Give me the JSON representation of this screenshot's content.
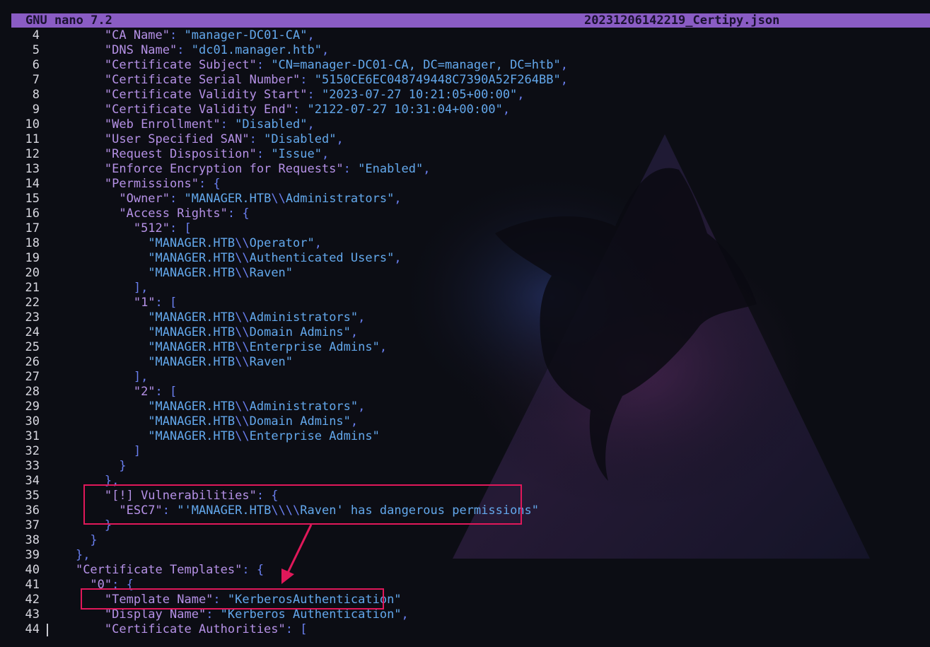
{
  "titlebar": {
    "app": "GNU nano 7.2",
    "filename": "20231206142219_Certipy.json"
  },
  "colors": {
    "titlebar_bg": "#8a5cc4",
    "json_key": "#b591e6",
    "json_string": "#63a8ec",
    "json_punct": "#6a7ff0",
    "highlight_box": "#e0185a",
    "background": "#0c0d14"
  },
  "lines": [
    {
      "n": "4",
      "indent": "    ",
      "tokens": [
        [
          "k",
          "\"CA Name\""
        ],
        [
          "p",
          ": "
        ],
        [
          "s",
          "\"manager-DC01-CA\""
        ],
        [
          "p",
          ","
        ]
      ]
    },
    {
      "n": "5",
      "indent": "    ",
      "tokens": [
        [
          "k",
          "\"DNS Name\""
        ],
        [
          "p",
          ": "
        ],
        [
          "s",
          "\"dc01.manager.htb\""
        ],
        [
          "p",
          ","
        ]
      ]
    },
    {
      "n": "6",
      "indent": "    ",
      "tokens": [
        [
          "k",
          "\"Certificate Subject\""
        ],
        [
          "p",
          ": "
        ],
        [
          "s",
          "\"CN=manager-DC01-CA, DC=manager, DC=htb\""
        ],
        [
          "p",
          ","
        ]
      ]
    },
    {
      "n": "7",
      "indent": "    ",
      "tokens": [
        [
          "k",
          "\"Certificate Serial Number\""
        ],
        [
          "p",
          ": "
        ],
        [
          "s",
          "\"5150CE6EC048749448C7390A52F264BB\""
        ],
        [
          "p",
          ","
        ]
      ]
    },
    {
      "n": "8",
      "indent": "    ",
      "tokens": [
        [
          "k",
          "\"Certificate Validity Start\""
        ],
        [
          "p",
          ": "
        ],
        [
          "s",
          "\"2023-07-27 10:21:05+00:00\""
        ],
        [
          "p",
          ","
        ]
      ]
    },
    {
      "n": "9",
      "indent": "    ",
      "tokens": [
        [
          "k",
          "\"Certificate Validity End\""
        ],
        [
          "p",
          ": "
        ],
        [
          "s",
          "\"2122-07-27 10:31:04+00:00\""
        ],
        [
          "p",
          ","
        ]
      ]
    },
    {
      "n": "10",
      "indent": "    ",
      "tokens": [
        [
          "k",
          "\"Web Enrollment\""
        ],
        [
          "p",
          ": "
        ],
        [
          "s",
          "\"Disabled\""
        ],
        [
          "p",
          ","
        ]
      ]
    },
    {
      "n": "11",
      "indent": "    ",
      "tokens": [
        [
          "k",
          "\"User Specified SAN\""
        ],
        [
          "p",
          ": "
        ],
        [
          "s",
          "\"Disabled\""
        ],
        [
          "p",
          ","
        ]
      ]
    },
    {
      "n": "12",
      "indent": "    ",
      "tokens": [
        [
          "k",
          "\"Request Disposition\""
        ],
        [
          "p",
          ": "
        ],
        [
          "s",
          "\"Issue\""
        ],
        [
          "p",
          ","
        ]
      ]
    },
    {
      "n": "13",
      "indent": "    ",
      "tokens": [
        [
          "k",
          "\"Enforce Encryption for Requests\""
        ],
        [
          "p",
          ": "
        ],
        [
          "s",
          "\"Enabled\""
        ],
        [
          "p",
          ","
        ]
      ]
    },
    {
      "n": "14",
      "indent": "    ",
      "tokens": [
        [
          "k",
          "\"Permissions\""
        ],
        [
          "p",
          ": {"
        ]
      ]
    },
    {
      "n": "15",
      "indent": "      ",
      "tokens": [
        [
          "k",
          "\"Owner\""
        ],
        [
          "p",
          ": "
        ],
        [
          "s",
          "\"MANAGER.HTB"
        ],
        [
          "p",
          "\\\\"
        ],
        [
          "s",
          "Administrators\""
        ],
        [
          "p",
          ","
        ]
      ]
    },
    {
      "n": "16",
      "indent": "      ",
      "tokens": [
        [
          "k",
          "\"Access Rights\""
        ],
        [
          "p",
          ": {"
        ]
      ]
    },
    {
      "n": "17",
      "indent": "        ",
      "tokens": [
        [
          "k",
          "\"512\""
        ],
        [
          "p",
          ": ["
        ]
      ]
    },
    {
      "n": "18",
      "indent": "          ",
      "tokens": [
        [
          "s",
          "\"MANAGER.HTB"
        ],
        [
          "p",
          "\\\\"
        ],
        [
          "s",
          "Operator\""
        ],
        [
          "p",
          ","
        ]
      ]
    },
    {
      "n": "19",
      "indent": "          ",
      "tokens": [
        [
          "s",
          "\"MANAGER.HTB"
        ],
        [
          "p",
          "\\\\"
        ],
        [
          "s",
          "Authenticated Users\""
        ],
        [
          "p",
          ","
        ]
      ]
    },
    {
      "n": "20",
      "indent": "          ",
      "tokens": [
        [
          "s",
          "\"MANAGER.HTB"
        ],
        [
          "p",
          "\\\\"
        ],
        [
          "s",
          "Raven\""
        ]
      ]
    },
    {
      "n": "21",
      "indent": "        ",
      "tokens": [
        [
          "p",
          "],"
        ]
      ]
    },
    {
      "n": "22",
      "indent": "        ",
      "tokens": [
        [
          "k",
          "\"1\""
        ],
        [
          "p",
          ": ["
        ]
      ]
    },
    {
      "n": "23",
      "indent": "          ",
      "tokens": [
        [
          "s",
          "\"MANAGER.HTB"
        ],
        [
          "p",
          "\\\\"
        ],
        [
          "s",
          "Administrators\""
        ],
        [
          "p",
          ","
        ]
      ]
    },
    {
      "n": "24",
      "indent": "          ",
      "tokens": [
        [
          "s",
          "\"MANAGER.HTB"
        ],
        [
          "p",
          "\\\\"
        ],
        [
          "s",
          "Domain Admins\""
        ],
        [
          "p",
          ","
        ]
      ]
    },
    {
      "n": "25",
      "indent": "          ",
      "tokens": [
        [
          "s",
          "\"MANAGER.HTB"
        ],
        [
          "p",
          "\\\\"
        ],
        [
          "s",
          "Enterprise Admins\""
        ],
        [
          "p",
          ","
        ]
      ]
    },
    {
      "n": "26",
      "indent": "          ",
      "tokens": [
        [
          "s",
          "\"MANAGER.HTB"
        ],
        [
          "p",
          "\\\\"
        ],
        [
          "s",
          "Raven\""
        ]
      ]
    },
    {
      "n": "27",
      "indent": "        ",
      "tokens": [
        [
          "p",
          "],"
        ]
      ]
    },
    {
      "n": "28",
      "indent": "        ",
      "tokens": [
        [
          "k",
          "\"2\""
        ],
        [
          "p",
          ": ["
        ]
      ]
    },
    {
      "n": "29",
      "indent": "          ",
      "tokens": [
        [
          "s",
          "\"MANAGER.HTB"
        ],
        [
          "p",
          "\\\\"
        ],
        [
          "s",
          "Administrators\""
        ],
        [
          "p",
          ","
        ]
      ]
    },
    {
      "n": "30",
      "indent": "          ",
      "tokens": [
        [
          "s",
          "\"MANAGER.HTB"
        ],
        [
          "p",
          "\\\\"
        ],
        [
          "s",
          "Domain Admins\""
        ],
        [
          "p",
          ","
        ]
      ]
    },
    {
      "n": "31",
      "indent": "          ",
      "tokens": [
        [
          "s",
          "\"MANAGER.HTB"
        ],
        [
          "p",
          "\\\\"
        ],
        [
          "s",
          "Enterprise Admins\""
        ]
      ]
    },
    {
      "n": "32",
      "indent": "        ",
      "tokens": [
        [
          "p",
          "]"
        ]
      ]
    },
    {
      "n": "33",
      "indent": "      ",
      "tokens": [
        [
          "p",
          "}"
        ]
      ]
    },
    {
      "n": "34",
      "indent": "    ",
      "tokens": [
        [
          "p",
          "},"
        ]
      ]
    },
    {
      "n": "35",
      "indent": "    ",
      "tokens": [
        [
          "k",
          "\"[!] Vulnerabilities\""
        ],
        [
          "p",
          ": {"
        ]
      ]
    },
    {
      "n": "36",
      "indent": "      ",
      "tokens": [
        [
          "k",
          "\"ESC7\""
        ],
        [
          "p",
          ": "
        ],
        [
          "s",
          "\"'MANAGER.HTB"
        ],
        [
          "p",
          "\\\\\\\\"
        ],
        [
          "s",
          "Raven' has dangerous permissions\""
        ]
      ]
    },
    {
      "n": "37",
      "indent": "    ",
      "tokens": [
        [
          "p",
          "}"
        ]
      ]
    },
    {
      "n": "38",
      "indent": "  ",
      "tokens": [
        [
          "p",
          "}"
        ]
      ]
    },
    {
      "n": "39",
      "indent": "",
      "tokens": [
        [
          "p",
          "},"
        ]
      ]
    },
    {
      "n": "40",
      "indent": "",
      "tokens": [
        [
          "k",
          "\"Certificate Templates\""
        ],
        [
          "p",
          ": {"
        ]
      ]
    },
    {
      "n": "41",
      "indent": "  ",
      "tokens": [
        [
          "k",
          "\"0\""
        ],
        [
          "p",
          ": {"
        ]
      ]
    },
    {
      "n": "42",
      "indent": "    ",
      "tokens": [
        [
          "k",
          "\"Template Name\""
        ],
        [
          "p",
          ": "
        ],
        [
          "s",
          "\"KerberosAuthentication\""
        ]
      ]
    },
    {
      "n": "43",
      "indent": "    ",
      "tokens": [
        [
          "k",
          "\"Display Name\""
        ],
        [
          "p",
          ": "
        ],
        [
          "s",
          "\"Kerberos Authentication\""
        ],
        [
          "p",
          ","
        ]
      ]
    },
    {
      "n": "44",
      "indent": "    ",
      "tokens": [
        [
          "k",
          "\"Certificate Authorities\""
        ],
        [
          "p",
          ": ["
        ]
      ]
    }
  ]
}
